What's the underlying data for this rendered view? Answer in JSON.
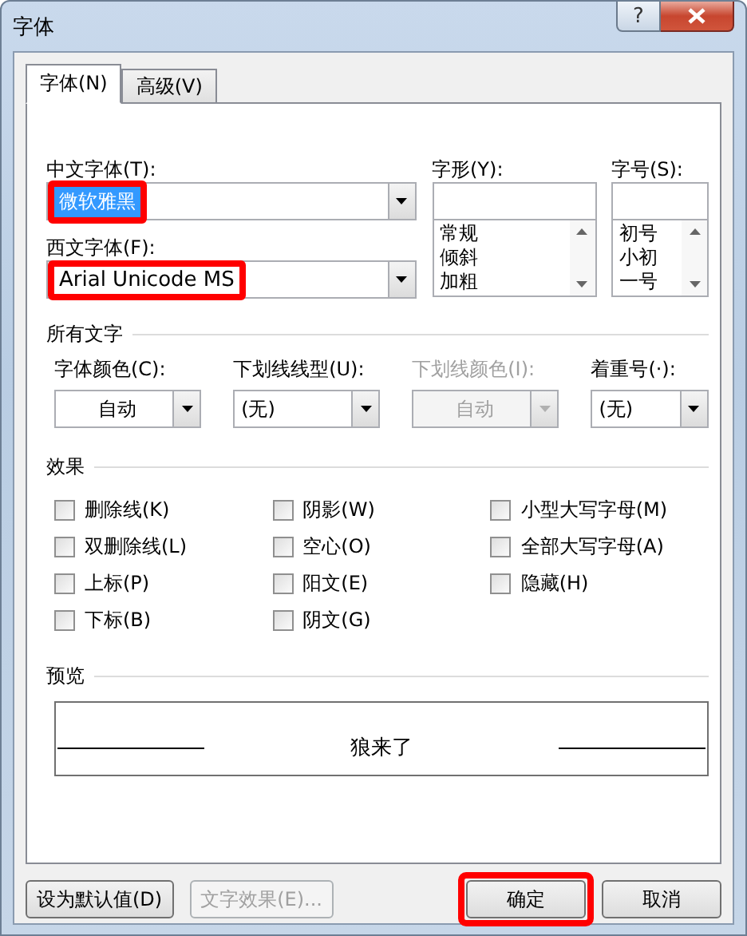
{
  "window": {
    "title": "字体",
    "help_button": "?"
  },
  "tabs": [
    {
      "label": "字体(N)",
      "selected": true
    },
    {
      "label": "高级(V)",
      "selected": false
    }
  ],
  "font_fields": [
    {
      "label": "中文字体(T):",
      "value": "微软雅黑",
      "text_selected": true,
      "highlighted": true
    },
    {
      "label": "西文字体(F):",
      "value": "Arial Unicode MS",
      "text_selected": false,
      "highlighted": true
    }
  ],
  "style_list": {
    "label": "字形(Y):",
    "items": [
      "常规",
      "倾斜",
      "加粗"
    ]
  },
  "size_list": {
    "label": "字号(S):",
    "items": [
      "初号",
      "小初",
      "一号"
    ]
  },
  "all_text": {
    "heading": "所有文字",
    "dropdowns": [
      {
        "kind": "color",
        "label": "字体颜色(C):",
        "value": "自动",
        "disabled": false
      },
      {
        "kind": "list",
        "label": "下划线线型(U):",
        "value": "(无)",
        "disabled": false
      },
      {
        "kind": "color",
        "label": "下划线颜色(I):",
        "value": "自动",
        "disabled": true
      },
      {
        "kind": "list",
        "label": "着重号(·):",
        "value": "(无)",
        "disabled": false
      }
    ]
  },
  "effects": {
    "heading": "效果",
    "columns": [
      [
        {
          "label": "删除线(K)",
          "checked": false
        },
        {
          "label": "双删除线(L)",
          "checked": false
        },
        {
          "label": "上标(P)",
          "checked": false
        },
        {
          "label": "下标(B)",
          "checked": false
        }
      ],
      [
        {
          "label": "阴影(W)",
          "checked": false
        },
        {
          "label": "空心(O)",
          "checked": false
        },
        {
          "label": "阳文(E)",
          "checked": false
        },
        {
          "label": "阴文(G)",
          "checked": false
        }
      ],
      [
        {
          "label": "小型大写字母(M)",
          "checked": false
        },
        {
          "label": "全部大写字母(A)",
          "checked": false
        },
        {
          "label": "隐藏(H)",
          "checked": false
        }
      ]
    ]
  },
  "preview": {
    "heading": "预览",
    "sample": "狼来了"
  },
  "buttons": [
    {
      "label": "设为默认值(D)",
      "disabled": false,
      "highlighted": false
    },
    {
      "label": "文字效果(E)...",
      "disabled": true,
      "highlighted": false
    },
    {
      "label": "确定",
      "disabled": false,
      "highlighted": true
    },
    {
      "label": "取消",
      "disabled": false,
      "highlighted": false
    }
  ]
}
